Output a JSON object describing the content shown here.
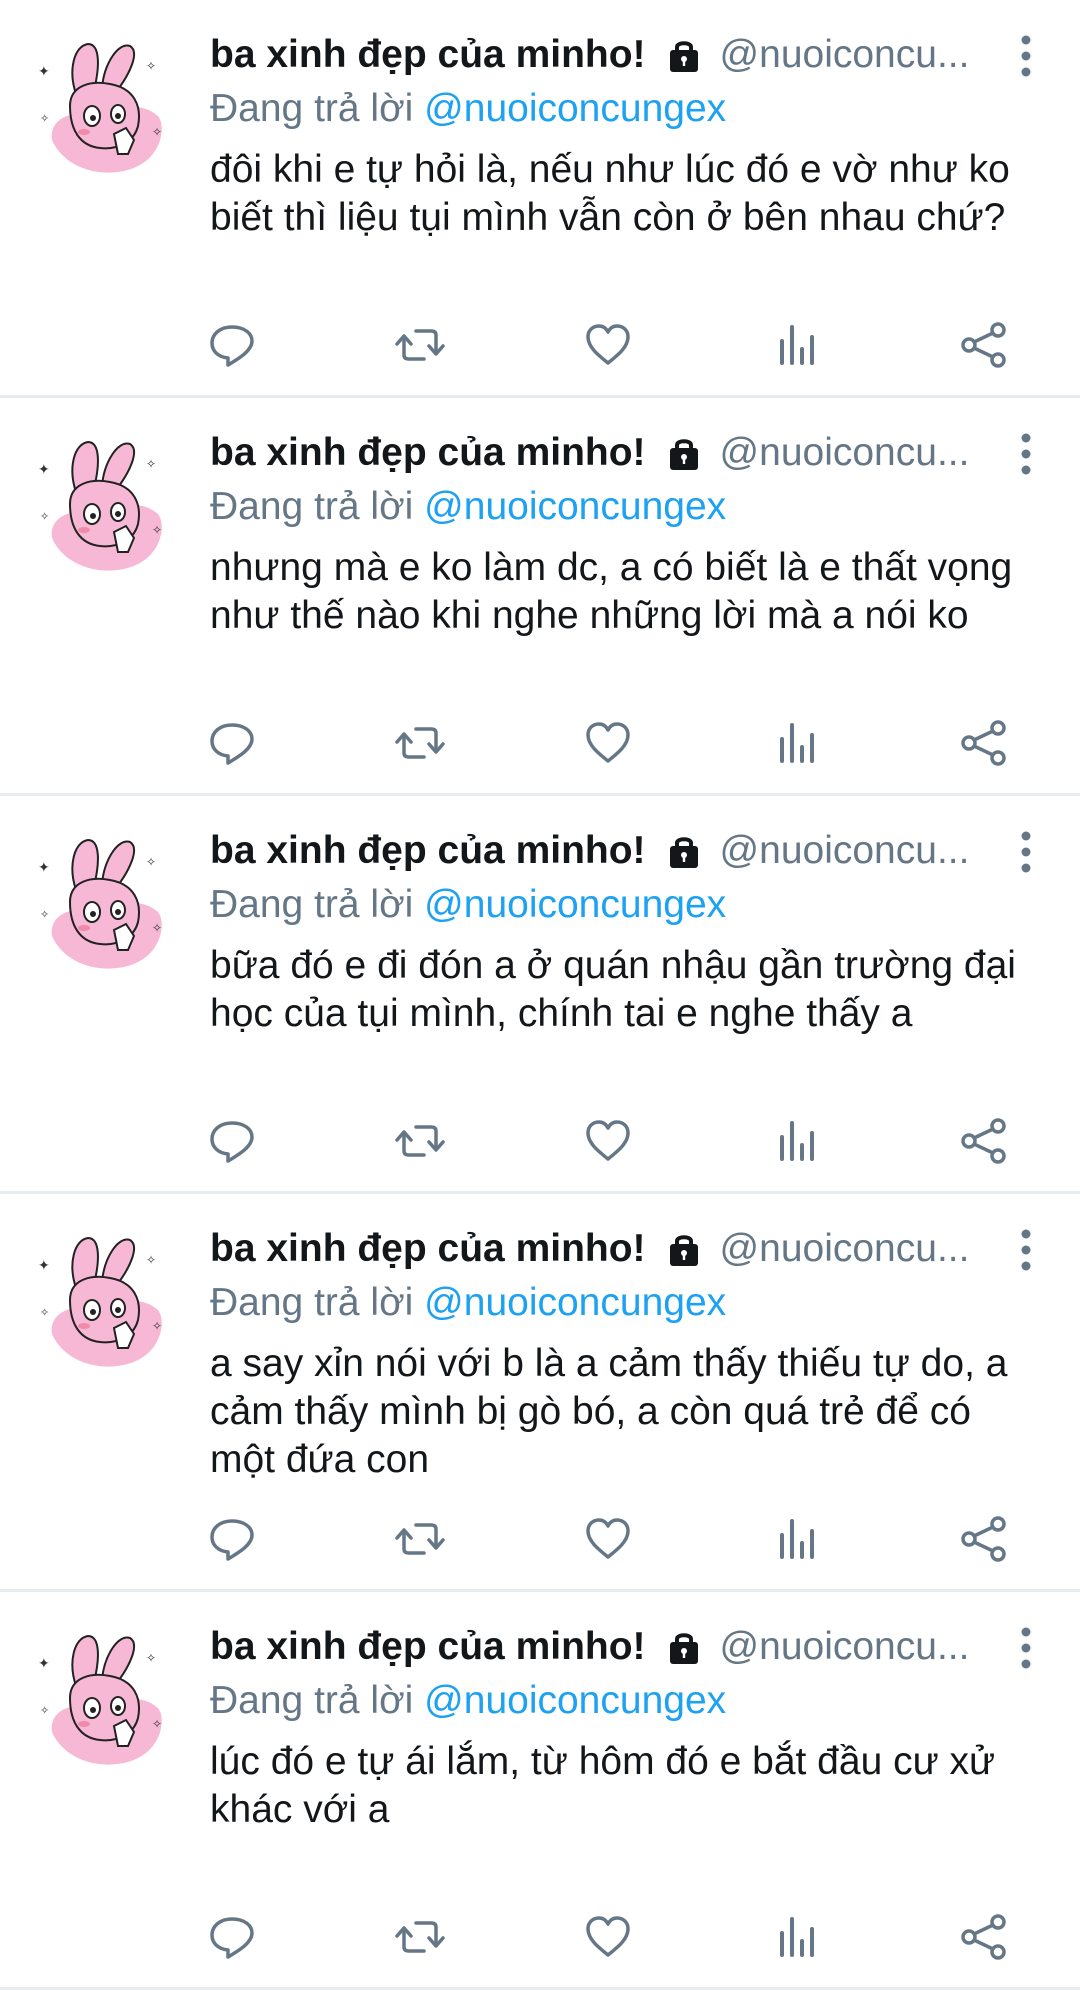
{
  "tweets": [
    {
      "name": "ba xinh đẹp của minho!",
      "handle": "@nuoiconcu...",
      "reply_prefix": "Đang trả lời",
      "reply_to": "@nuoiconcungex",
      "text": "đôi khi e tự hỏi là, nếu như lúc đó e vờ như ko biết thì liệu tụi mình vẫn còn ở bên nhau chứ?"
    },
    {
      "name": "ba xinh đẹp của minho!",
      "handle": "@nuoiconcu...",
      "reply_prefix": "Đang trả lời",
      "reply_to": "@nuoiconcungex",
      "text": "nhưng mà e ko làm dc, a có biết là e thất vọng như thế nào khi nghe những lời mà a nói ko"
    },
    {
      "name": "ba xinh đẹp của minho!",
      "handle": "@nuoiconcu...",
      "reply_prefix": "Đang trả lời",
      "reply_to": "@nuoiconcungex",
      "text": "bữa đó e đi đón a ở quán nhậu gần trường đại học của tụi mình, chính tai e nghe thấy a"
    },
    {
      "name": "ba xinh đẹp của minho!",
      "handle": "@nuoiconcu...",
      "reply_prefix": "Đang trả lời",
      "reply_to": "@nuoiconcungex",
      "text": "a say xỉn nói với b là a cảm thấy thiếu tự do, a cảm thấy mình bị gò bó, a còn quá trẻ để có một đứa con"
    },
    {
      "name": "ba xinh đẹp của minho!",
      "handle": "@nuoiconcu...",
      "reply_prefix": "Đang trả lời",
      "reply_to": "@nuoiconcungex",
      "text": "lúc đó e tự ái lắm, từ hôm đó e bắt đầu cư xử khác với a"
    }
  ],
  "icons": {
    "lock": "lock-icon",
    "more": "more-vertical-icon",
    "reply": "reply-icon",
    "retweet": "retweet-icon",
    "like": "heart-icon",
    "analytics": "analytics-icon",
    "share": "share-icon"
  },
  "colors": {
    "name": "#14171a",
    "secondary": "#657786",
    "mention": "#1da1f2",
    "divider": "#e6ecf0",
    "avatar_pink": "#f7b8d6"
  }
}
